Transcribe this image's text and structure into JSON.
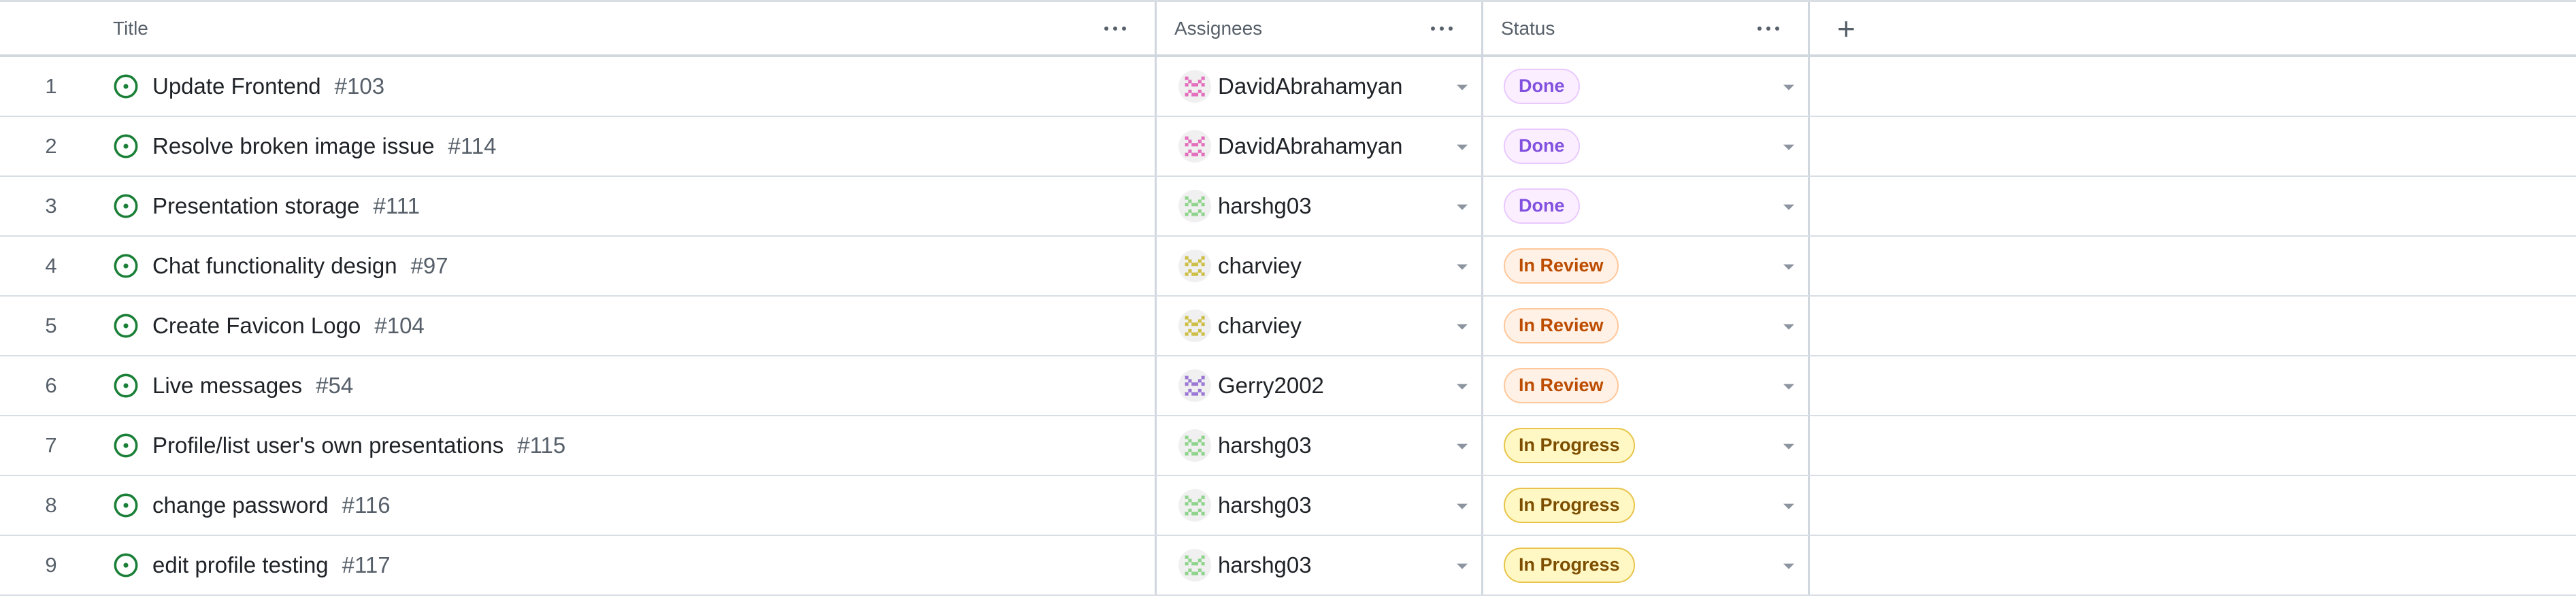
{
  "columns": {
    "title": "Title",
    "assignees": "Assignees",
    "status": "Status",
    "add_column_icon": "plus-icon"
  },
  "colors": {
    "open_issue": "#1a7f37",
    "done_text": "#8250df",
    "in_review_text": "#bc4c00",
    "in_progress_text": "#7d4e00"
  },
  "rows": [
    {
      "number": "1",
      "title": "Update Frontend",
      "issue": "#103",
      "assignee": "DavidAbrahamyan",
      "avatar_color": "#e36fbd",
      "status": "Done"
    },
    {
      "number": "2",
      "title": "Resolve broken image issue",
      "issue": "#114",
      "assignee": "DavidAbrahamyan",
      "avatar_color": "#e36fbd",
      "status": "Done"
    },
    {
      "number": "3",
      "title": "Presentation storage",
      "issue": "#111",
      "assignee": "harshg03",
      "avatar_color": "#8fd48c",
      "status": "Done"
    },
    {
      "number": "4",
      "title": "Chat functionality design",
      "issue": "#97",
      "assignee": "charviey",
      "avatar_color": "#cdbf45",
      "status": "In Review"
    },
    {
      "number": "5",
      "title": "Create Favicon Logo",
      "issue": "#104",
      "assignee": "charviey",
      "avatar_color": "#cdbf45",
      "status": "In Review"
    },
    {
      "number": "6",
      "title": "Live messages",
      "issue": "#54",
      "assignee": "Gerry2002",
      "avatar_color": "#9b78d6",
      "status": "In Review"
    },
    {
      "number": "7",
      "title": "Profile/list user's own presentations",
      "issue": "#115",
      "assignee": "harshg03",
      "avatar_color": "#8fd48c",
      "status": "In Progress"
    },
    {
      "number": "8",
      "title": "change password",
      "issue": "#116",
      "assignee": "harshg03",
      "avatar_color": "#8fd48c",
      "status": "In Progress"
    },
    {
      "number": "9",
      "title": "edit profile testing",
      "issue": "#117",
      "assignee": "harshg03",
      "avatar_color": "#8fd48c",
      "status": "In Progress"
    }
  ]
}
